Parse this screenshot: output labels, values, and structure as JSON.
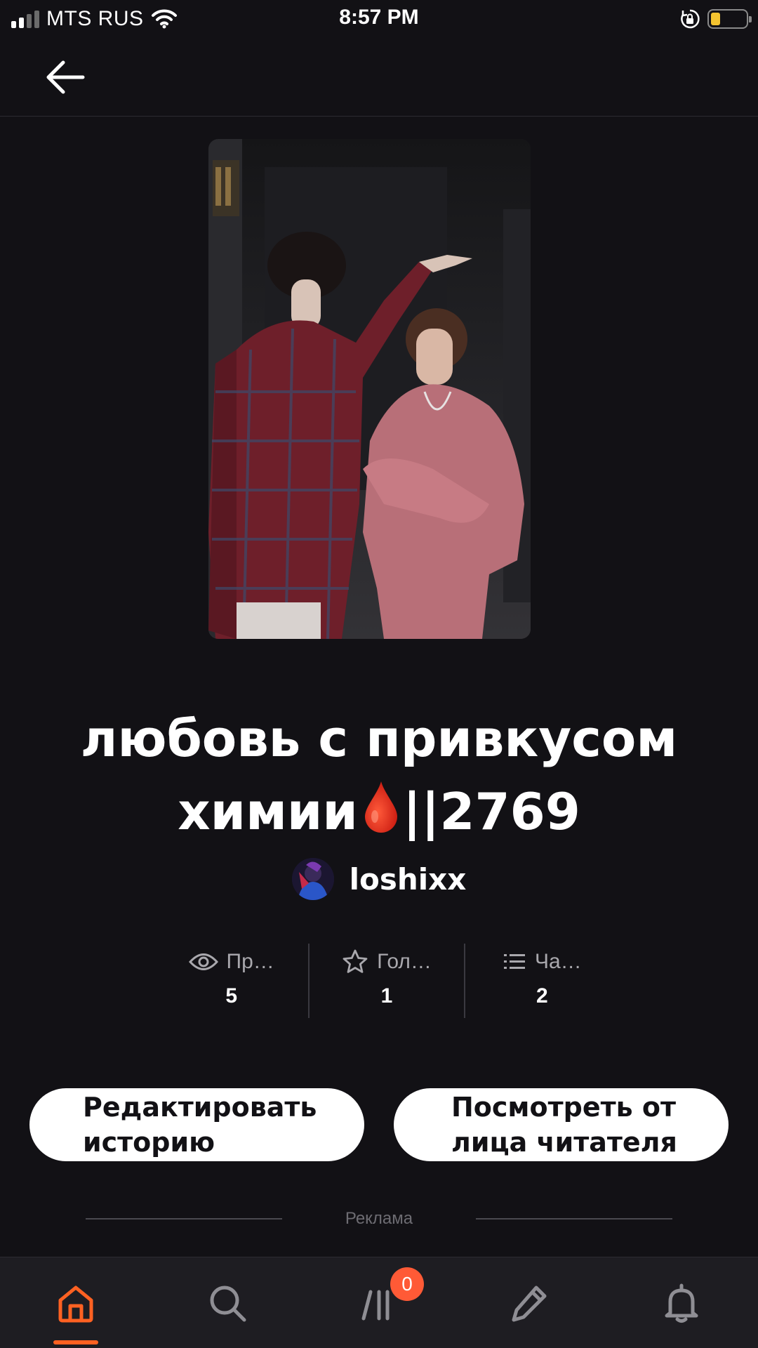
{
  "status_bar": {
    "carrier": "MTS RUS",
    "time": "8:57 PM",
    "battery_level": 0.2,
    "battery_color": "#f4c430"
  },
  "top_bar": {
    "back_icon": "arrow-left-icon"
  },
  "story": {
    "title_line1": "любовь с привкусом",
    "title_line2_before": "химии",
    "title_line2_after": "||2769",
    "title_emoji": "blood-drop-icon",
    "author": "loshixx"
  },
  "stats": [
    {
      "icon": "eye-icon",
      "label": "Пр…",
      "value": "5"
    },
    {
      "icon": "star-icon",
      "label": "Гол…",
      "value": "1"
    },
    {
      "icon": "list-icon",
      "label": "Ча…",
      "value": "2"
    }
  ],
  "buttons": {
    "edit_line1": "Редактировать",
    "edit_line2": "историю",
    "preview_line1": "Посмотреть от",
    "preview_line2": "лица читателя"
  },
  "ad": {
    "label": "Реклама"
  },
  "bottom_nav": {
    "items": [
      "home-icon",
      "search-icon",
      "library-icon",
      "pencil-icon",
      "bell-icon"
    ],
    "active": "home-icon",
    "library_badge": "0",
    "accent_color": "#ff6122"
  }
}
